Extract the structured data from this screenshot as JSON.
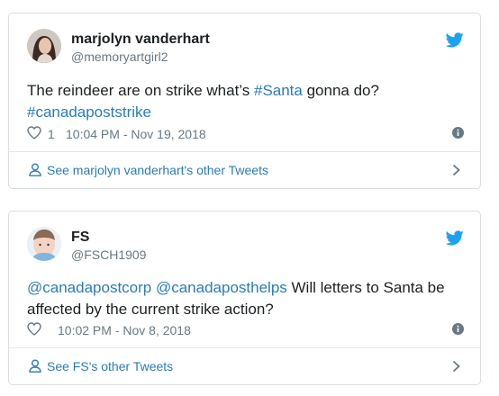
{
  "tweets": [
    {
      "display_name": "marjolyn vanderhart",
      "handle": "@memoryartgirl2",
      "text_plain": "The reindeer are on strike what’s ",
      "text_link1": "#Santa",
      "text_plain2": " gonna do?",
      "text_link2": "#canadapoststrike",
      "likes": "1",
      "timestamp": "10:04 PM - Nov 19, 2018",
      "footer_link": "See marjolyn vanderhart's other Tweets"
    },
    {
      "display_name": "FS",
      "handle": "@FSCH1909",
      "text_link1": "@canadapostcorp",
      "text_link2": "@canadaposthelps",
      "text_plain": " Will letters to Santa be affected by the current strike action?",
      "timestamp": "10:02 PM - Nov 8, 2018",
      "footer_link": "See FS's other Tweets"
    }
  ],
  "colors": {
    "link": "#2b7bb9",
    "twitter_blue": "#1da1f2",
    "meta_gray": "#697882",
    "border": "#d9dfe4"
  },
  "icons": [
    "twitter-bird-icon",
    "heart-icon",
    "info-icon",
    "person-icon",
    "chevron-right-icon"
  ]
}
